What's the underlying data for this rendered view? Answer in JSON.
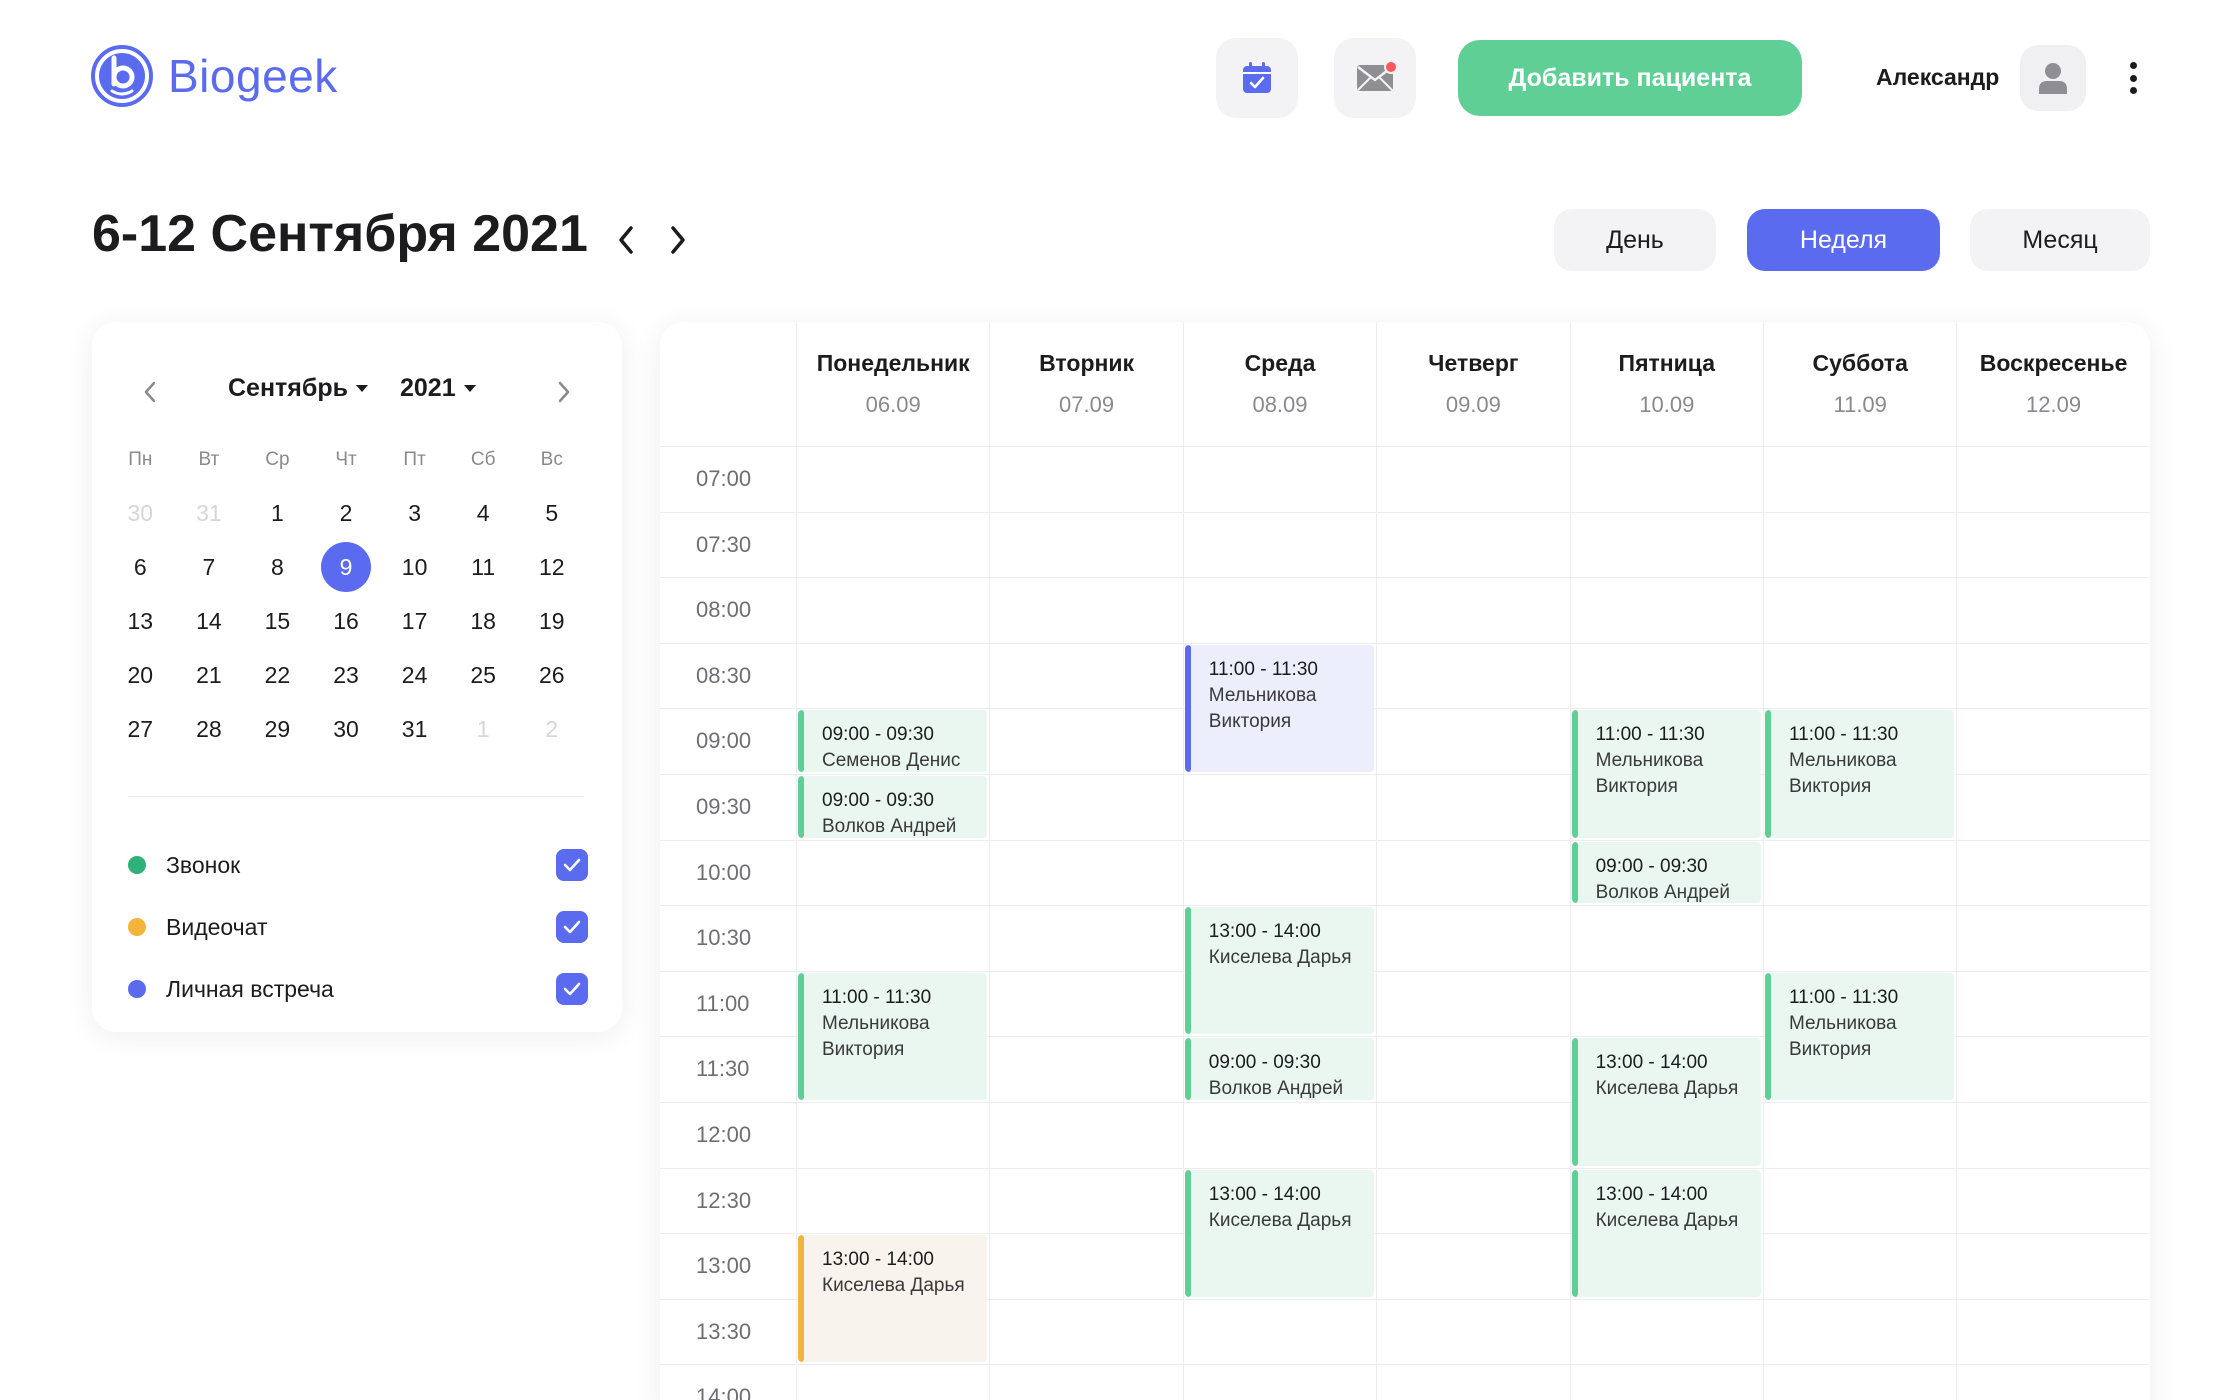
{
  "brand": {
    "name": "Biogeek"
  },
  "header": {
    "add_patient_label": "Добавить пациента",
    "user_name": "Александр",
    "icons": {
      "calendar": "calendar-check-icon",
      "mail": "mail-icon",
      "avatar": "user-icon",
      "more": "more-vertical-icon"
    }
  },
  "page": {
    "title": "6-12 Сентября 2021",
    "views": {
      "day": "День",
      "week": "Неделя",
      "month": "Месяц"
    },
    "active_view": "Неделя"
  },
  "mini_calendar": {
    "month": "Сентябрь",
    "year": "2021",
    "weekdays": [
      "Пн",
      "Вт",
      "Ср",
      "Чт",
      "Пт",
      "Сб",
      "Вс"
    ],
    "weeks": [
      [
        {
          "d": "30",
          "muted": true
        },
        {
          "d": "31",
          "muted": true
        },
        {
          "d": "1"
        },
        {
          "d": "2"
        },
        {
          "d": "3"
        },
        {
          "d": "4"
        },
        {
          "d": "5"
        }
      ],
      [
        {
          "d": "6"
        },
        {
          "d": "7"
        },
        {
          "d": "8"
        },
        {
          "d": "9",
          "selected": true
        },
        {
          "d": "10"
        },
        {
          "d": "11"
        },
        {
          "d": "12"
        }
      ],
      [
        {
          "d": "13"
        },
        {
          "d": "14"
        },
        {
          "d": "15"
        },
        {
          "d": "16"
        },
        {
          "d": "17"
        },
        {
          "d": "18"
        },
        {
          "d": "19"
        }
      ],
      [
        {
          "d": "20"
        },
        {
          "d": "21"
        },
        {
          "d": "22"
        },
        {
          "d": "23"
        },
        {
          "d": "24"
        },
        {
          "d": "25"
        },
        {
          "d": "26"
        }
      ],
      [
        {
          "d": "27"
        },
        {
          "d": "28"
        },
        {
          "d": "29"
        },
        {
          "d": "30"
        },
        {
          "d": "31"
        },
        {
          "d": "1",
          "muted": true
        },
        {
          "d": "2",
          "muted": true
        }
      ]
    ]
  },
  "legend": [
    {
      "label": "Звонок",
      "color": "#2fb27a",
      "checked": true
    },
    {
      "label": "Видеочат",
      "color": "#f2b53a",
      "checked": true
    },
    {
      "label": "Личная встреча",
      "color": "#5b6bf0",
      "checked": true
    }
  ],
  "schedule": {
    "days": [
      {
        "name": "Понедельник",
        "date": "06.09"
      },
      {
        "name": "Вторник",
        "date": "07.09"
      },
      {
        "name": "Среда",
        "date": "08.09"
      },
      {
        "name": "Четверг",
        "date": "09.09"
      },
      {
        "name": "Пятница",
        "date": "10.09"
      },
      {
        "name": "Суббота",
        "date": "11.09"
      },
      {
        "name": "Воскресенье",
        "date": "12.09"
      }
    ],
    "times": [
      "07:00",
      "07:30",
      "08:00",
      "08:30",
      "09:00",
      "09:30",
      "10:00",
      "10:30",
      "11:00",
      "11:30",
      "12:00",
      "12:30",
      "13:00",
      "13:30",
      "14:00"
    ],
    "events": [
      {
        "day": 0,
        "slot": 4,
        "span": 1,
        "kind": "call",
        "time": "09:00 - 09:30",
        "name": "Семенов Денис"
      },
      {
        "day": 0,
        "slot": 5,
        "span": 1,
        "kind": "call",
        "time": "09:00 - 09:30",
        "name": "Волков Андрей"
      },
      {
        "day": 0,
        "slot": 8,
        "span": 2,
        "kind": "call",
        "time": "11:00 - 11:30",
        "name": "Мельникова Виктория"
      },
      {
        "day": 0,
        "slot": 12,
        "span": 2,
        "kind": "video",
        "time": "13:00 - 14:00",
        "name": "Киселева Дарья"
      },
      {
        "day": 2,
        "slot": 3,
        "span": 2,
        "kind": "meeting",
        "time": "11:00 - 11:30",
        "name": "Мельникова Виктория"
      },
      {
        "day": 2,
        "slot": 7,
        "span": 2,
        "kind": "call",
        "time": "13:00 - 14:00",
        "name": "Киселева Дарья"
      },
      {
        "day": 2,
        "slot": 9,
        "span": 1,
        "kind": "call",
        "time": "09:00 - 09:30",
        "name": "Волков Андрей"
      },
      {
        "day": 2,
        "slot": 11,
        "span": 2,
        "kind": "call",
        "time": "13:00 - 14:00",
        "name": "Киселева Дарья"
      },
      {
        "day": 4,
        "slot": 4,
        "span": 2,
        "kind": "call",
        "time": "11:00 - 11:30",
        "name": "Мельникова Виктория"
      },
      {
        "day": 4,
        "slot": 6,
        "span": 1,
        "kind": "call",
        "time": "09:00 - 09:30",
        "name": "Волков Андрей"
      },
      {
        "day": 4,
        "slot": 9,
        "span": 2,
        "kind": "call",
        "time": "13:00 - 14:00",
        "name": "Киселева Дарья"
      },
      {
        "day": 4,
        "slot": 11,
        "span": 2,
        "kind": "call",
        "time": "13:00 - 14:00",
        "name": "Киселева Дарья"
      },
      {
        "day": 5,
        "slot": 4,
        "span": 2,
        "kind": "call",
        "time": "11:00 - 11:30",
        "name": "Мельникова Виктория"
      },
      {
        "day": 5,
        "slot": 8,
        "span": 2,
        "kind": "call",
        "time": "11:00 - 11:30",
        "name": "Мельникова Виктория"
      }
    ],
    "kind_styles": {
      "call": {
        "bar": "#5fcf95",
        "bg": "#e9f7f0"
      },
      "video": {
        "bar": "#f2b53a",
        "bg": "#f8f3ec"
      },
      "meeting": {
        "bar": "#5b6bf0",
        "bg": "#eceefb"
      }
    }
  },
  "colors": {
    "accent": "#5b6bf0",
    "add_button": "#5fcf95",
    "notification": "#ff5a5a"
  }
}
